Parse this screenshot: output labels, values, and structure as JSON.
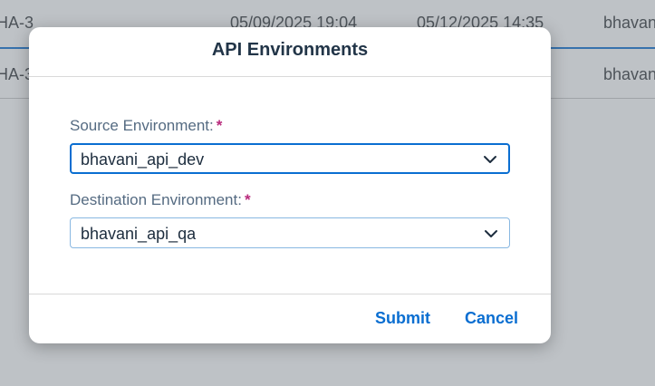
{
  "background_table": {
    "rows": [
      {
        "id": "HA-3",
        "created": "05/09/2025 19:04",
        "modified": "05/12/2025 14:35",
        "user": "bhavani"
      },
      {
        "id": "HA-3",
        "created": "",
        "modified": "",
        "user": "bhavani"
      }
    ]
  },
  "dialog": {
    "title": "API Environments",
    "source": {
      "label": "Source Environment:",
      "required_marker": "*",
      "value": "bhavani_api_dev",
      "icon": "chevron-down-icon"
    },
    "destination": {
      "label": "Destination Environment:",
      "required_marker": "*",
      "value": "bhavani_api_qa",
      "icon": "chevron-down-icon"
    },
    "buttons": {
      "submit": "Submit",
      "cancel": "Cancel"
    }
  },
  "colors": {
    "accent": "#0a6ed1",
    "required": "#b8297b",
    "title": "#223548",
    "label": "#556b82"
  }
}
